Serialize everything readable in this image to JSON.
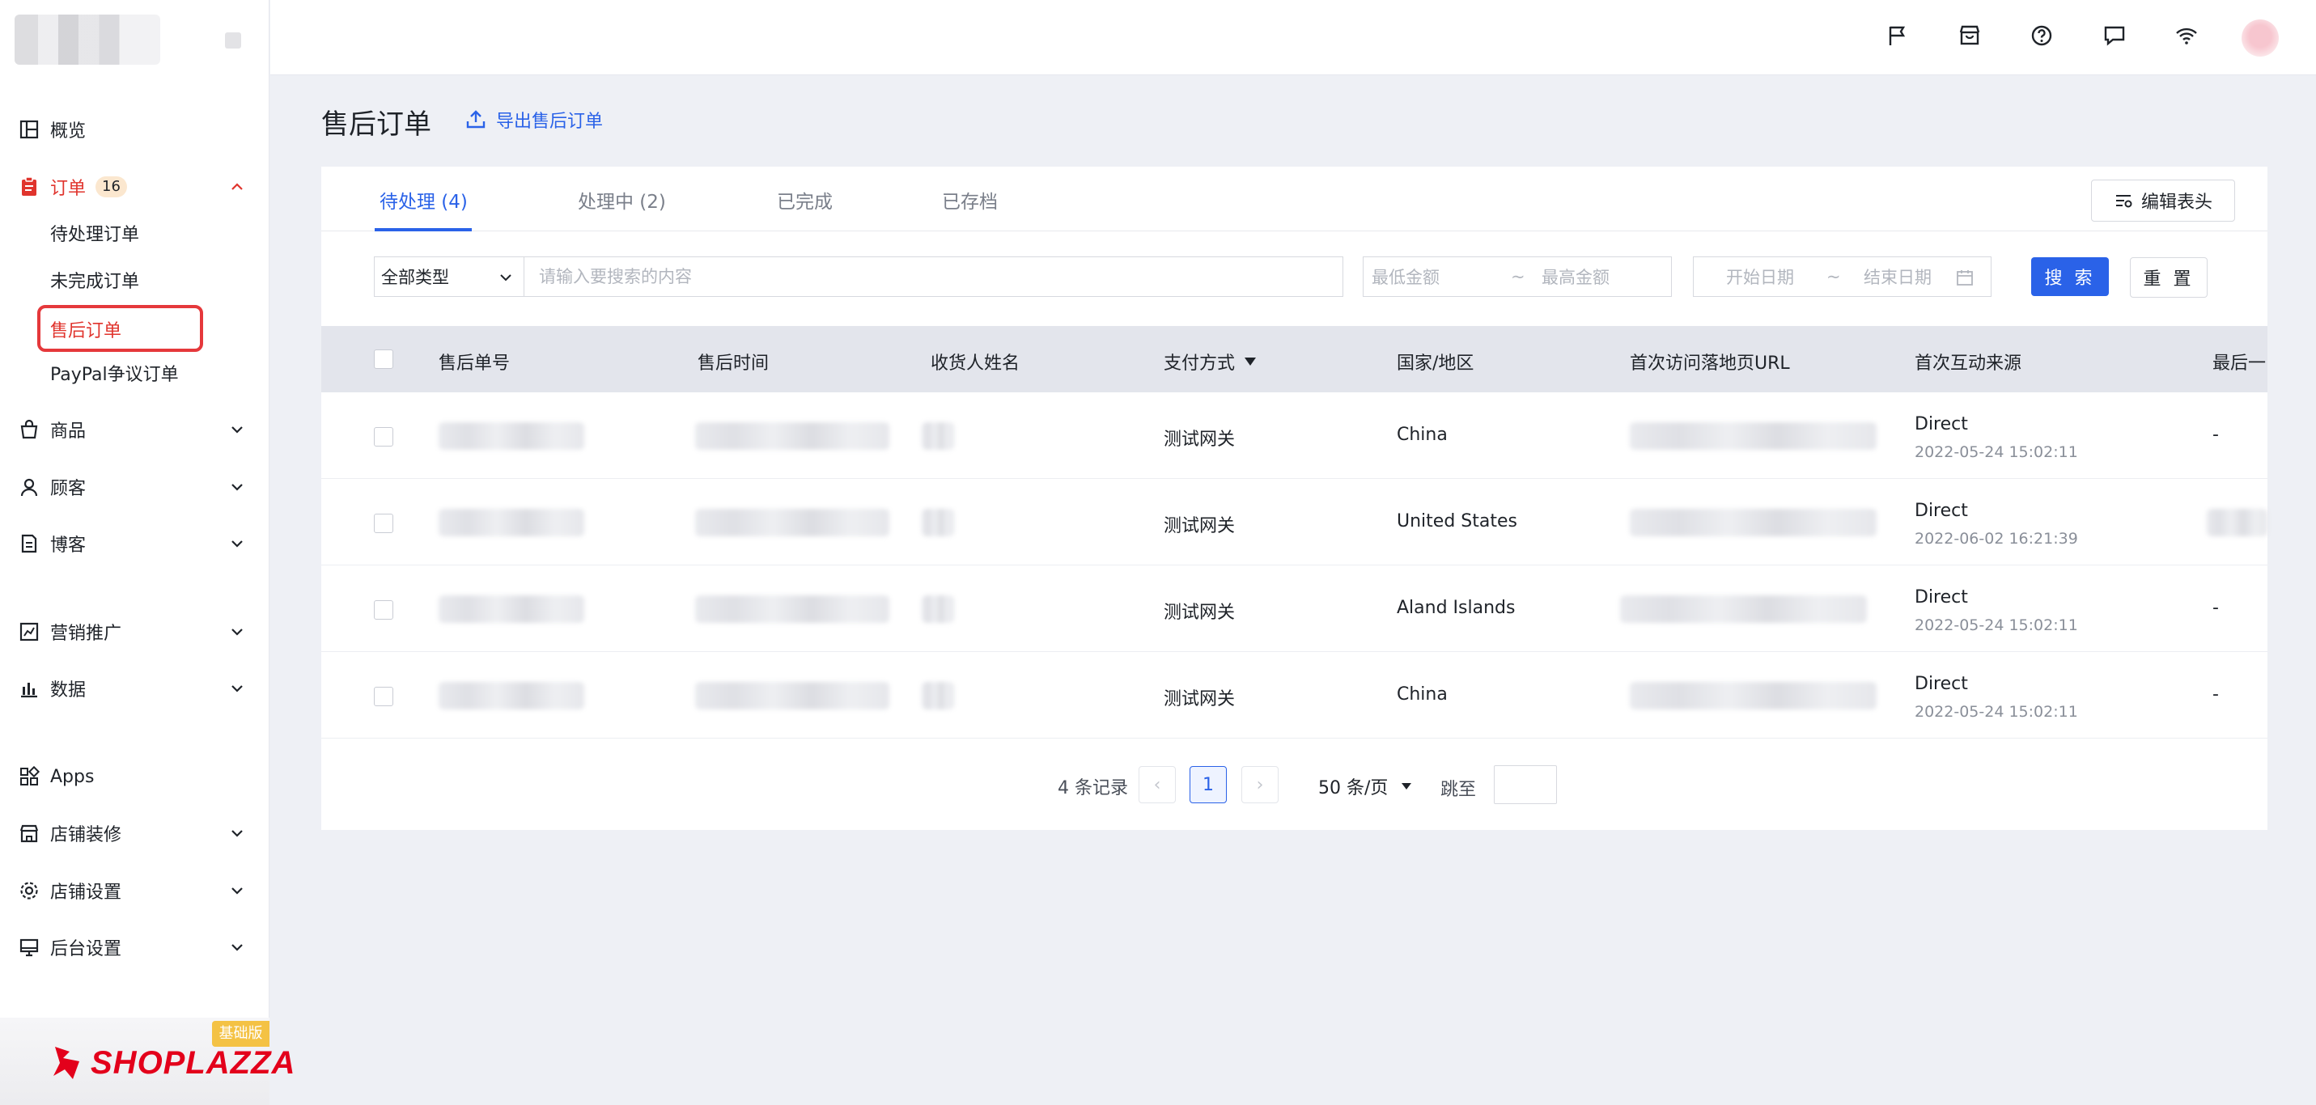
{
  "sidebar": {
    "items": [
      {
        "label": "概览",
        "icon": "dashboard-icon"
      },
      {
        "label": "订单",
        "icon": "order-icon",
        "badge": "16",
        "expanded": true
      },
      {
        "label": "商品",
        "icon": "product-bag-icon"
      },
      {
        "label": "顾客",
        "icon": "customer-icon"
      },
      {
        "label": "博客",
        "icon": "blog-icon"
      },
      {
        "label": "营销推广",
        "icon": "marketing-icon"
      },
      {
        "label": "数据",
        "icon": "analytics-icon"
      },
      {
        "label": "Apps",
        "icon": "apps-icon"
      },
      {
        "label": "店铺装修",
        "icon": "store-design-icon"
      },
      {
        "label": "店铺设置",
        "icon": "settings-gear-icon"
      },
      {
        "label": "后台设置",
        "icon": "admin-monitor-icon"
      }
    ],
    "order_sub": [
      "待处理订单",
      "未完成订单",
      "售后订单",
      "PayPal争议订单"
    ],
    "active_sub": "售后订单"
  },
  "brand": {
    "name": "SHOPLAZZA",
    "plan": "基础版"
  },
  "page": {
    "title": "售后订单",
    "export_label": "导出售后订单"
  },
  "tabs": [
    {
      "label": "待处理 (4)",
      "active": true
    },
    {
      "label": "处理中 (2)",
      "active": false
    },
    {
      "label": "已完成",
      "active": false
    },
    {
      "label": "已存档",
      "active": false
    }
  ],
  "edit_header_label": "编辑表头",
  "filters": {
    "type_value": "全部类型",
    "search_placeholder": "请输入要搜索的内容",
    "min_amount": "最低金额",
    "max_amount": "最高金额",
    "start_date": "开始日期",
    "end_date": "结束日期",
    "range_sep": "~",
    "search_btn": "搜 索",
    "reset_btn": "重 置"
  },
  "table": {
    "columns": [
      "售后单号",
      "售后时间",
      "收货人姓名",
      "支付方式",
      "国家/地区",
      "首次访问落地页URL",
      "首次互动来源",
      "最后一"
    ],
    "rows": [
      {
        "payment": "测试网关",
        "country": "China",
        "source": "Direct",
        "source_time": "2022-05-24 15:02:11",
        "last": "-"
      },
      {
        "payment": "测试网关",
        "country": "United States",
        "source": "Direct",
        "source_time": "2022-06-02 16:21:39",
        "last": ""
      },
      {
        "payment": "测试网关",
        "country": "Aland Islands",
        "source": "Direct",
        "source_time": "2022-05-24 15:02:11",
        "last": "-"
      },
      {
        "payment": "测试网关",
        "country": "China",
        "source": "Direct",
        "source_time": "2022-05-24 15:02:11",
        "last": "-"
      }
    ]
  },
  "pagination": {
    "total": "4 条记录",
    "current_page": "1",
    "page_size": "50 条/页",
    "jump_label": "跳至",
    "prev": "‹",
    "next": "›"
  },
  "colors": {
    "primary": "#2a62e8",
    "active_red": "#e0342d",
    "badge_bg": "#fbe7cf",
    "brand_red": "#e3001b",
    "plan_tag": "#f4c244"
  }
}
